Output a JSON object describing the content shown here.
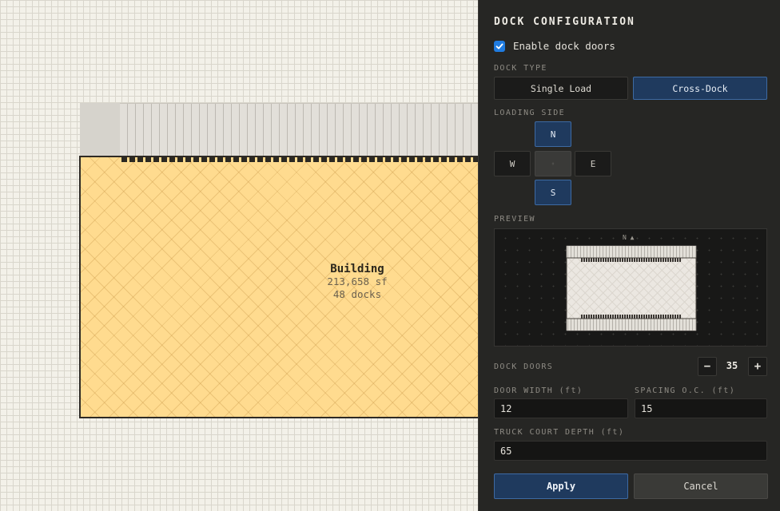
{
  "canvas": {
    "building": {
      "name": "Building",
      "area": "213,658 sf",
      "docks": "48 docks"
    }
  },
  "panel": {
    "title": "DOCK CONFIGURATION",
    "enable_label": "Enable dock doors",
    "enable_checked": true,
    "dock_type": {
      "label": "DOCK TYPE",
      "options": [
        "Single Load",
        "Cross-Dock"
      ],
      "selected": "Cross-Dock"
    },
    "loading_side": {
      "label": "LOADING SIDE",
      "north": "N",
      "west": "W",
      "center": "◦",
      "east": "E",
      "south": "S",
      "selected": [
        "N",
        "S"
      ]
    },
    "preview": {
      "label": "PREVIEW",
      "north_indicator": "N ▲"
    },
    "dock_doors": {
      "label": "DOCK DOORS",
      "value": "35",
      "minus": "−",
      "plus": "+"
    },
    "door_width": {
      "label": "DOOR WIDTH (ft)",
      "value": "12"
    },
    "spacing": {
      "label": "SPACING O.C. (ft)",
      "value": "15"
    },
    "truck_court": {
      "label": "TRUCK COURT DEPTH (ft)",
      "value": "65"
    },
    "apply_label": "Apply",
    "cancel_label": "Cancel"
  },
  "colors": {
    "building_fill": "#ffdb8f",
    "accent": "#1f3a5e",
    "accent_border": "#3d6aa3",
    "checkbox": "#1f7be0",
    "panel_bg": "#262624"
  },
  "icons": [
    "checkmark-icon",
    "north-arrow-icon"
  ]
}
